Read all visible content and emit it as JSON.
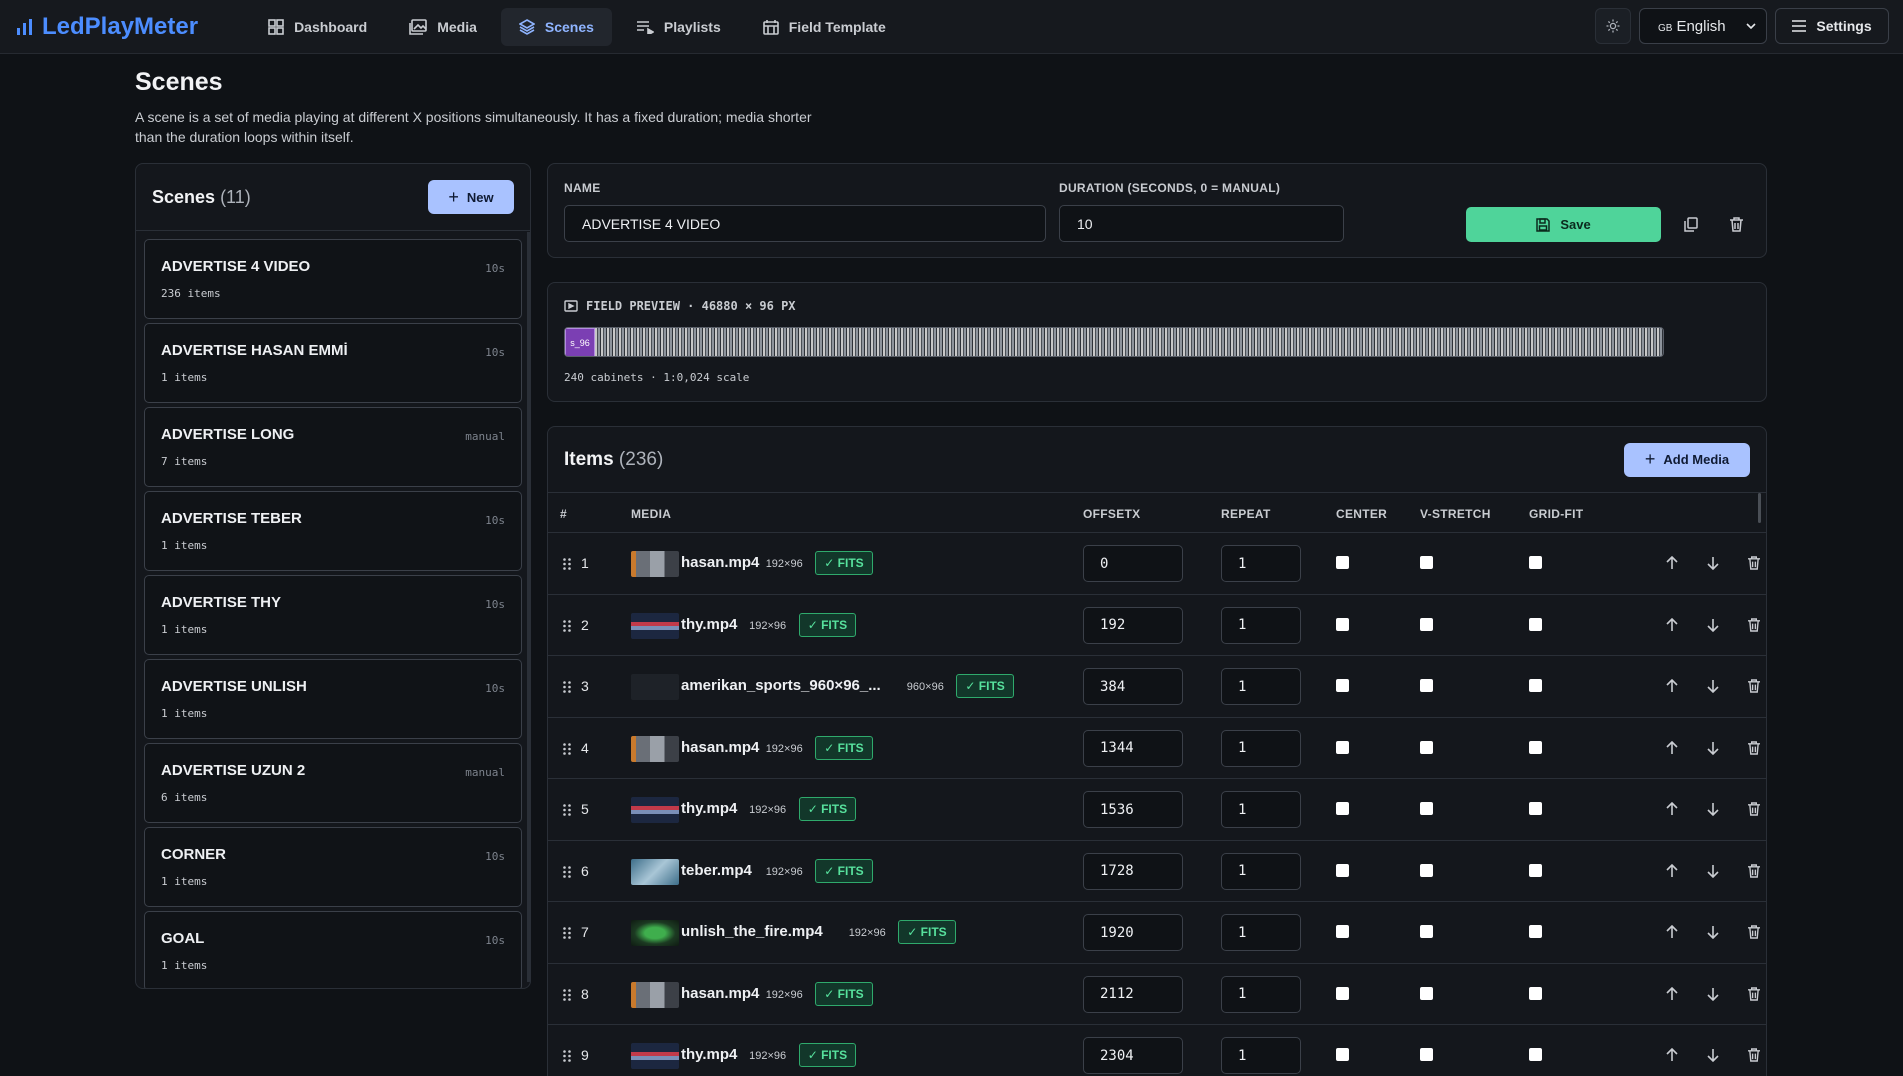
{
  "app": {
    "name": "LedPlayMeter"
  },
  "nav": {
    "items": [
      {
        "label": "Dashboard",
        "icon": "dashboard-icon",
        "active": false
      },
      {
        "label": "Media",
        "icon": "media-icon",
        "active": false
      },
      {
        "label": "Scenes",
        "icon": "layers-icon",
        "active": true
      },
      {
        "label": "Playlists",
        "icon": "playlist-icon",
        "active": false
      },
      {
        "label": "Field Template",
        "icon": "calendar-grid-icon",
        "active": false
      }
    ],
    "language": "English",
    "language_flag": "GB",
    "settings_label": "Settings"
  },
  "page": {
    "title": "Scenes",
    "description": "A scene is a set of media playing at different X positions simultaneously. It has a fixed duration; media shorter than the duration loops within itself."
  },
  "scenes_panel": {
    "title": "Scenes",
    "count": "(11)",
    "new_label": "New",
    "items": [
      {
        "name": "ADVERTISE 4 VIDEO",
        "duration": "10s",
        "items": "236 items"
      },
      {
        "name": "ADVERTISE HASAN EMMİ",
        "duration": "10s",
        "items": "1 items"
      },
      {
        "name": "ADVERTISE LONG",
        "duration": "manual",
        "items": "7 items"
      },
      {
        "name": "ADVERTISE TEBER",
        "duration": "10s",
        "items": "1 items"
      },
      {
        "name": "ADVERTISE THY",
        "duration": "10s",
        "items": "1 items"
      },
      {
        "name": "ADVERTISE UNLISH",
        "duration": "10s",
        "items": "1 items"
      },
      {
        "name": "ADVERTISE UZUN 2",
        "duration": "manual",
        "items": "6 items"
      },
      {
        "name": "CORNER",
        "duration": "10s",
        "items": "1 items"
      },
      {
        "name": "GOAL",
        "duration": "10s",
        "items": "1 items"
      }
    ]
  },
  "editor": {
    "name_label": "NAME",
    "name_value": "ADVERTISE 4 VIDEO",
    "duration_label": "DURATION (SECONDS, 0 = MANUAL)",
    "duration_value": "10",
    "save_label": "Save"
  },
  "preview": {
    "label": "FIELD PREVIEW · 46880 × 96 PX",
    "selected_tag": "s_96",
    "footer": "240 cabinets · 1:0,024 scale"
  },
  "items_panel": {
    "title": "Items",
    "count": "(236)",
    "add_label": "Add Media",
    "columns": [
      "#",
      "MEDIA",
      "OFFSETX",
      "REPEAT",
      "CENTER",
      "V-STRETCH",
      "GRID-FIT"
    ],
    "rows": [
      {
        "n": "1",
        "media": "hasan.mp4",
        "res": "192×96",
        "fit": "✓ FITS",
        "offsetx": "0",
        "repeat": "1",
        "center": false,
        "vstretch": false,
        "gridfit": false
      },
      {
        "n": "2",
        "media": "thy.mp4",
        "res": "192×96",
        "fit": "✓ FITS",
        "offsetx": "192",
        "repeat": "1",
        "center": false,
        "vstretch": false,
        "gridfit": false
      },
      {
        "n": "3",
        "media": "amerikan_sports_960×96_...",
        "res": "960×96",
        "fit": "✓ FITS",
        "offsetx": "384",
        "repeat": "1",
        "center": false,
        "vstretch": false,
        "gridfit": false
      },
      {
        "n": "4",
        "media": "hasan.mp4",
        "res": "192×96",
        "fit": "✓ FITS",
        "offsetx": "1344",
        "repeat": "1",
        "center": false,
        "vstretch": false,
        "gridfit": false
      },
      {
        "n": "5",
        "media": "thy.mp4",
        "res": "192×96",
        "fit": "✓ FITS",
        "offsetx": "1536",
        "repeat": "1",
        "center": false,
        "vstretch": false,
        "gridfit": false
      },
      {
        "n": "6",
        "media": "teber.mp4",
        "res": "192×96",
        "fit": "✓ FITS",
        "offsetx": "1728",
        "repeat": "1",
        "center": false,
        "vstretch": false,
        "gridfit": false
      },
      {
        "n": "7",
        "media": "unlish_the_fire.mp4",
        "res": "192×96",
        "fit": "✓ FITS",
        "offsetx": "1920",
        "repeat": "1",
        "center": false,
        "vstretch": false,
        "gridfit": false
      },
      {
        "n": "8",
        "media": "hasan.mp4",
        "res": "192×96",
        "fit": "✓ FITS",
        "offsetx": "2112",
        "repeat": "1",
        "center": false,
        "vstretch": false,
        "gridfit": false
      },
      {
        "n": "9",
        "media": "thy.mp4",
        "res": "192×96",
        "fit": "✓ FITS",
        "offsetx": "2304",
        "repeat": "1",
        "center": false,
        "vstretch": false,
        "gridfit": false
      }
    ]
  },
  "colors": {
    "accent": "#4c8dff",
    "save": "#4fd49a",
    "fits": "#57e19d",
    "primary_button": "#a9c2ff"
  }
}
